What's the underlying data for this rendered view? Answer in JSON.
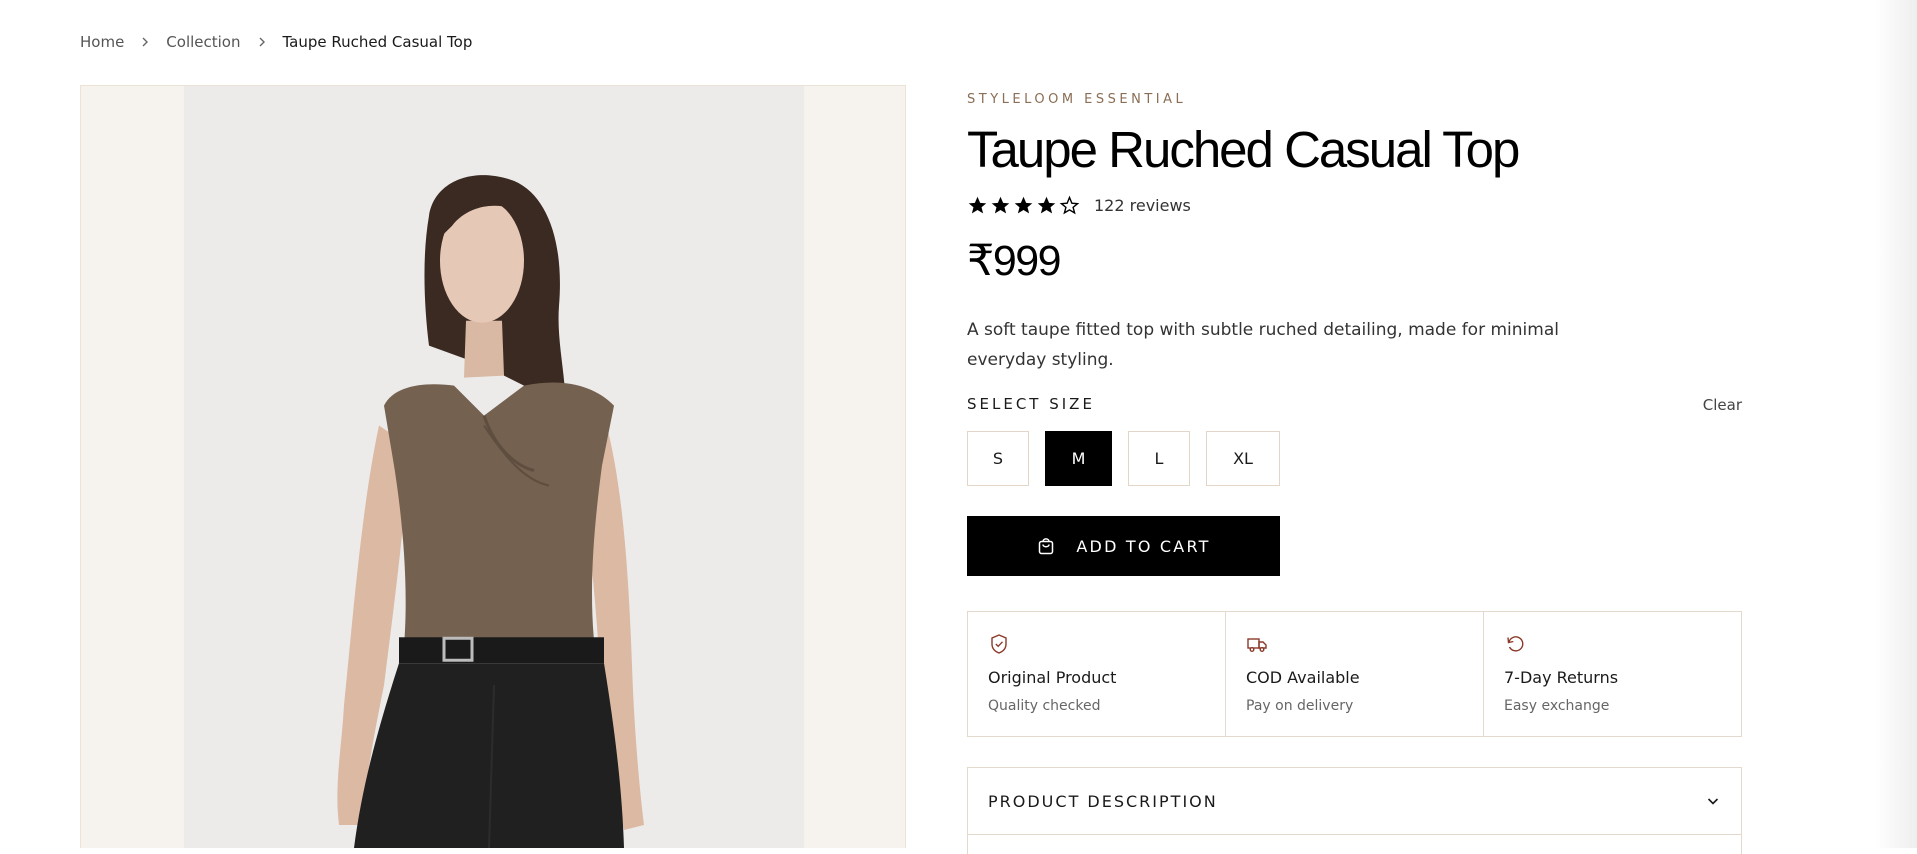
{
  "breadcrumb": {
    "home": "Home",
    "collection": "Collection",
    "current": "Taupe Ruched Casual Top"
  },
  "product": {
    "brand": "STYLELOOM ESSENTIAL",
    "title": "Taupe Ruched Casual Top",
    "rating": 4,
    "rating_max": 5,
    "reviews_label": "122 reviews",
    "price": "₹999",
    "description": "A soft taupe fitted top with subtle ruched detailing, made for minimal everyday styling."
  },
  "size_selector": {
    "label": "SELECT SIZE",
    "clear_label": "Clear",
    "options": [
      "S",
      "M",
      "L",
      "XL"
    ],
    "selected": "M"
  },
  "add_to_cart": {
    "label": "ADD TO CART",
    "icon": "shopping-bag-icon"
  },
  "features": [
    {
      "icon": "shield-check-icon",
      "title": "Original Product",
      "subtitle": "Quality checked"
    },
    {
      "icon": "delivery-truck-icon",
      "title": "COD Available",
      "subtitle": "Pay on delivery"
    },
    {
      "icon": "return-arrow-icon",
      "title": "7-Day Returns",
      "subtitle": "Easy exchange"
    }
  ],
  "accordion": {
    "title": "PRODUCT DESCRIPTION",
    "icon": "chevron-down-icon"
  },
  "colors": {
    "accent_brand": "#8a6e55",
    "icon_accent": "#8b3a2a",
    "button_bg": "#000000",
    "gallery_bg": "#f6f3ef"
  }
}
